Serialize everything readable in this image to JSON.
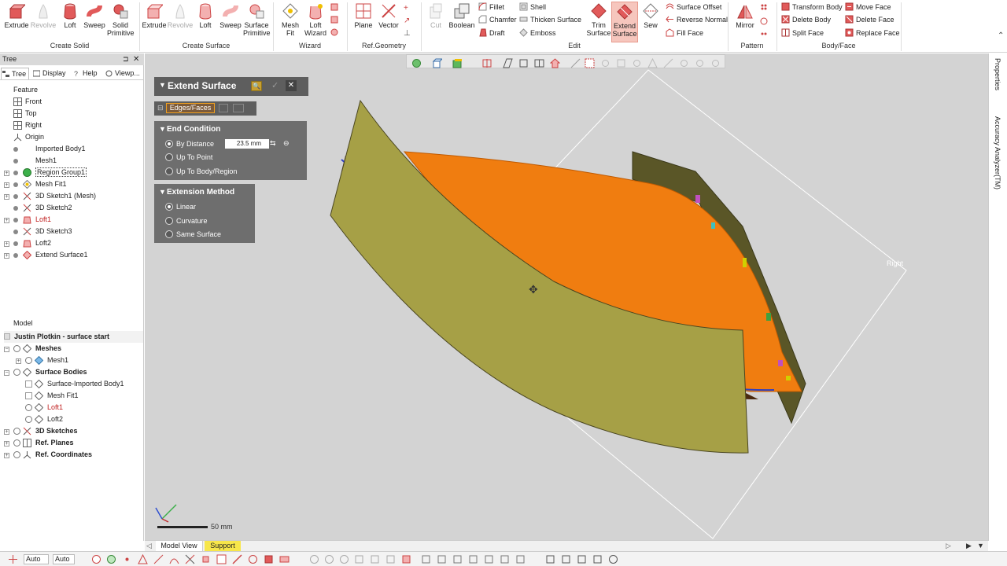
{
  "ribbon": {
    "create_solid": {
      "group": "Create Solid",
      "extrude": "Extrude",
      "revolve": "Revolve",
      "loft": "Loft",
      "sweep": "Sweep",
      "solid_primitive": "Solid Primitive"
    },
    "create_surface": {
      "group": "Create Surface",
      "extrude": "Extrude",
      "revolve": "Revolve",
      "loft": "Loft",
      "sweep": "Sweep",
      "surface_primitive": "Surface Primitive"
    },
    "wizard": {
      "group": "Wizard",
      "mesh_fit": "Mesh Fit",
      "loft_wizard": "Loft Wizard"
    },
    "ref_geometry": {
      "group": "Ref.Geometry",
      "plane": "Plane",
      "vector": "Vector"
    },
    "edit": {
      "group": "Edit",
      "cut": "Cut",
      "boolean": "Boolean",
      "fillet": "Fillet",
      "chamfer": "Chamfer",
      "draft": "Draft",
      "shell": "Shell",
      "thicken_surface": "Thicken Surface",
      "emboss": "Emboss",
      "trim_surface": "Trim Surface",
      "extend_surface": "Extend Surface",
      "sew": "Sew",
      "surface_offset": "Surface Offset",
      "reverse_normal": "Reverse Normal",
      "fill_face": "Fill Face"
    },
    "pattern": {
      "group": "Pattern",
      "mirror": "Mirror"
    },
    "body_face": {
      "group": "Body/Face",
      "transform_body": "Transform Body",
      "delete_body": "Delete Body",
      "split_face": "Split Face",
      "move_face": "Move Face",
      "delete_face": "Delete Face",
      "replace_face": "Replace Face"
    }
  },
  "left": {
    "title": "Tree",
    "tabs": [
      "Tree",
      "Display",
      "Help",
      "Viewp..."
    ],
    "feature_header": "Feature",
    "features": [
      "Front",
      "Top",
      "Right",
      "Origin",
      "Imported Body1",
      "Mesh1",
      "Region Group1",
      "Mesh Fit1",
      "3D Sketch1 (Mesh)",
      "3D Sketch2",
      "Loft1",
      "3D Sketch3",
      "Loft2",
      "Extend Surface1"
    ],
    "model_header": "Model",
    "model_root": "Justin Plotkin - surface start",
    "model": {
      "meshes": "Meshes",
      "mesh1": "Mesh1",
      "surface_bodies": "Surface Bodies",
      "surface_imported": "Surface-Imported Body1",
      "mesh_fit1": "Mesh Fit1",
      "loft1": "Loft1",
      "loft2": "Loft2",
      "sketches": "3D Sketches",
      "ref_planes": "Ref. Planes",
      "ref_coords": "Ref. Coordinates"
    }
  },
  "dialog": {
    "title": "Extend Surface",
    "tab_label": "Edges/Faces",
    "end_condition": {
      "title": "End Condition",
      "by_distance": "By Distance",
      "distance_value": "23.5 mm",
      "up_to_point": "Up To Point",
      "up_to_body": "Up To Body/Region"
    },
    "extension_method": {
      "title": "Extension Method",
      "linear": "Linear",
      "curvature": "Curvature",
      "same_surface": "Same Surface"
    }
  },
  "viewport": {
    "plane_label": "Right",
    "scale_label": "50 mm"
  },
  "right_panel": {
    "properties": "Properties",
    "accuracy": "Accuracy Analyzer(TM)"
  },
  "bottom_tabs": {
    "model_view": "Model View",
    "support": "Support"
  },
  "status": {
    "select_mode_1": "Auto",
    "select_mode_2": "Auto"
  },
  "colors": {
    "accent": "#e8734a",
    "panel_bg": "#6e6e6e",
    "surface_olive": "#a6a046",
    "surface_orange": "#f07d10",
    "viewport_bg": "#d3d3d3"
  }
}
